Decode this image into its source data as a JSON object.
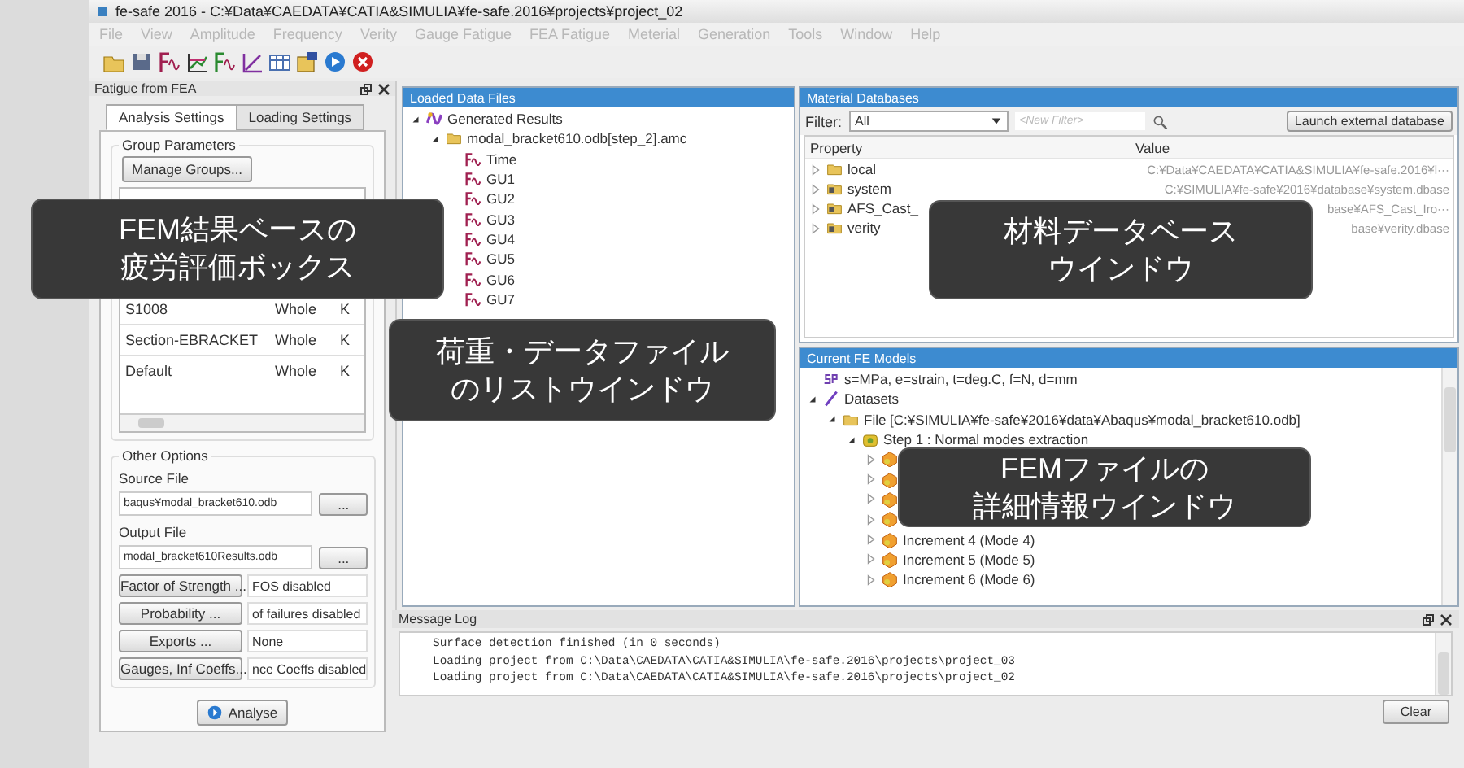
{
  "window": {
    "title": "fe-safe 2016 - C:¥Data¥CAEDATA¥CATIA&SIMULIA¥fe-safe.2016¥projects¥project_02"
  },
  "menu": [
    "File",
    "View",
    "Amplitude",
    "Frequency",
    "Verity",
    "Gauge Fatigue",
    "FEA Fatigue",
    "Meterial",
    "Generation",
    "Tools",
    "Window",
    "Help"
  ],
  "left_panel": {
    "title": "Fatigue from FEA",
    "tabs": [
      {
        "label": "Analysis Settings",
        "selected": true
      },
      {
        "label": "Loading Settings",
        "selected": false
      }
    ],
    "group_parameters": {
      "legend": "Group Parameters",
      "manage_button": "Manage Groups...",
      "rows": [
        {
          "column_1": "S1008",
          "column_2": "Whole",
          "column_3": "K"
        },
        {
          "column_1": "Section-EBRACKET",
          "column_2": "Whole",
          "column_3": "K"
        },
        {
          "column_1": "Default",
          "column_2": "Whole",
          "column_3": "K"
        }
      ]
    },
    "other_options": {
      "legend": "Other Options",
      "files": [
        {
          "label": "Source File",
          "value": "baqus¥modal_bracket610.odb",
          "button": "..."
        },
        {
          "label": "Output File",
          "value": "modal_bracket610Results.odb",
          "button": "..."
        }
      ],
      "option_rows": [
        {
          "button": "Factor of Strength ...",
          "value": "FOS disabled"
        },
        {
          "button": "Probability ...",
          "value": "of failures disabled"
        },
        {
          "button": "Exports ...",
          "value": "None"
        },
        {
          "button": "Gauges, Inf Coeffs...",
          "value": "nce Coeffs disabled"
        }
      ]
    },
    "analyse_button": "Analyse"
  },
  "loaded_data": {
    "title": "Loaded Data Files",
    "tree": [
      {
        "label": "Generated Results",
        "kind": "results",
        "expanded": true,
        "children": [
          {
            "label": "modal_bracket610.odb[step_2].amc",
            "kind": "folder",
            "expanded": true,
            "children": [
              {
                "label": "Time",
                "kind": "signal"
              },
              {
                "label": "GU1",
                "kind": "signal"
              },
              {
                "label": "GU2",
                "kind": "signal"
              },
              {
                "label": "GU3",
                "kind": "signal"
              },
              {
                "label": "GU4",
                "kind": "signal"
              },
              {
                "label": "GU5",
                "kind": "signal"
              },
              {
                "label": "GU6",
                "kind": "signal"
              },
              {
                "label": "GU7",
                "kind": "signal"
              }
            ]
          }
        ]
      }
    ]
  },
  "material_databases": {
    "title": "Material Databases",
    "filter_label": "Filter:",
    "filter_value": "All",
    "search_placeholder": "<New Filter>",
    "launch_button": "Launch external database",
    "columns": [
      "Property",
      "Value"
    ],
    "rows": [
      {
        "property": "local",
        "kind": "folder",
        "expanded": false,
        "value": "C:¥Data¥CAEDATA¥CATIA&SIMULIA¥fe-safe.2016¥l···"
      },
      {
        "property": "system",
        "kind": "database",
        "expanded": false,
        "value": "C:¥SIMULIA¥fe-safe¥2016¥database¥system.dbase"
      },
      {
        "property": "AFS_Cast_",
        "kind": "database",
        "expanded": false,
        "value": "base¥AFS_Cast_Iro···"
      },
      {
        "property": "verity",
        "kind": "database",
        "expanded": false,
        "value": "base¥verity.dbase"
      }
    ]
  },
  "fe_models": {
    "title": "Current FE Models",
    "tree": [
      {
        "label": "s=MPa, e=strain, t=deg.C, f=N, d=mm",
        "kind": "units"
      },
      {
        "label": "Datasets",
        "kind": "datasets",
        "expanded": true,
        "children": [
          {
            "label": "File [C:¥SIMULIA¥fe-safe¥2016¥data¥Abaqus¥modal_bracket610.odb]",
            "kind": "folder",
            "expanded": true,
            "children": [
              {
                "label": "Step 1 : Normal modes extraction",
                "kind": "step",
                "expanded": true,
                "children": [
                  {
                    "kind": "increment",
                    "expanded": false
                  },
                  {
                    "kind": "increment",
                    "expanded": false
                  },
                  {
                    "kind": "increment",
                    "expanded": false
                  },
                  {
                    "kind": "increment",
                    "expanded": false
                  },
                  {
                    "label": "Increment 4 (Mode 4)",
                    "kind": "increment",
                    "expanded": false
                  },
                  {
                    "label": "Increment 5 (Mode 5)",
                    "kind": "increment",
                    "expanded": false
                  },
                  {
                    "label": "Increment 6 (Mode 6)",
                    "kind": "increment",
                    "expanded": false
                  }
                ]
              }
            ]
          }
        ]
      }
    ]
  },
  "message_log": {
    "title": "Message Log",
    "lines": [
      "Surface detection finished (in 0 seconds)",
      "Loading project from C:\\Data\\CAEDATA\\CATIA&SIMULIA\\fe-safe.2016\\projects\\project_03",
      "Loading project from C:\\Data\\CAEDATA\\CATIA&SIMULIA\\fe-safe.2016\\projects\\project_02"
    ],
    "clear_button": "Clear"
  },
  "callouts": [
    {
      "lines": [
        "FEM結果ベースの",
        "疲労評価ボックス"
      ]
    },
    {
      "lines": [
        "荷重・データファイル",
        "のリストウインドウ"
      ]
    },
    {
      "lines": [
        "材料データベース",
        "ウインドウ"
      ]
    },
    {
      "lines": [
        "FEMファイルの",
        "詳細情報ウインドウ"
      ]
    }
  ]
}
